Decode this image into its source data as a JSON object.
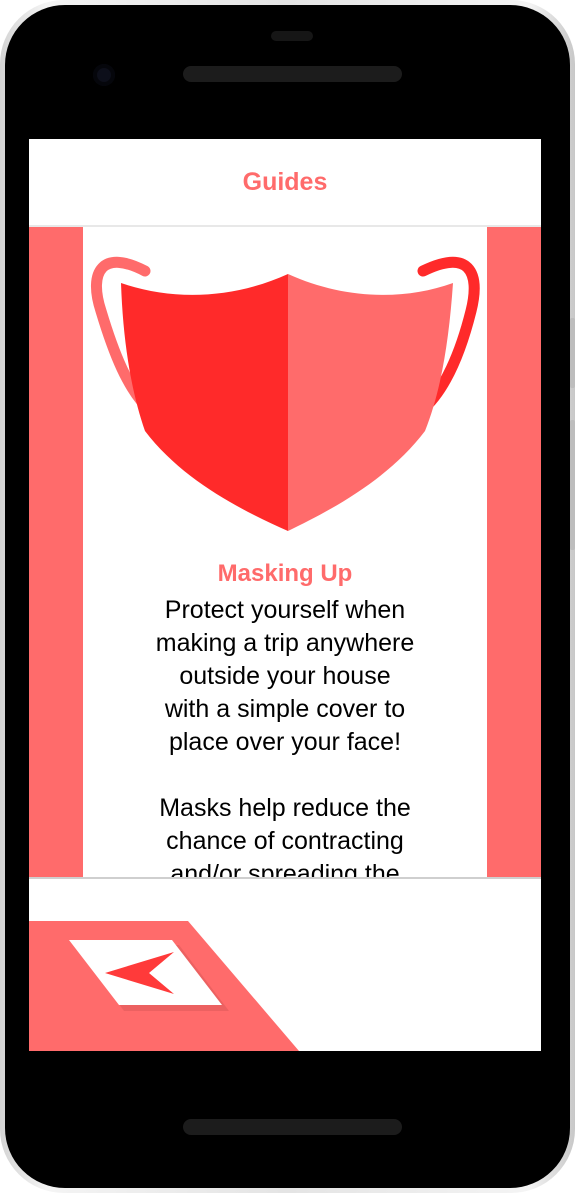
{
  "header": {
    "title": "Guides"
  },
  "guide": {
    "title": "Masking Up",
    "body": "Protect yourself when\nmaking a trip anywhere\noutside your house\nwith a simple cover to\nplace over your face!\n\nMasks help reduce the\nchance of contracting\nand/or spreading the"
  },
  "icons": {
    "illustration": "face-mask-illustration",
    "back": "back-arrow-icon"
  },
  "colors": {
    "accent": "#ff6b6b",
    "mask_dark": "#ff2a2a",
    "mask_light": "#ff6b6b"
  }
}
